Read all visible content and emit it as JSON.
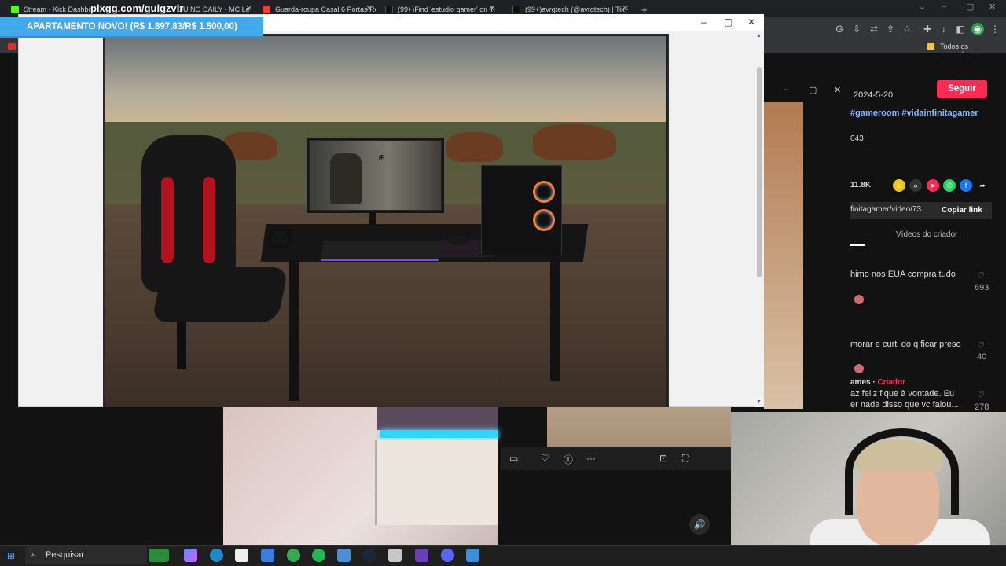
{
  "browser": {
    "tabs": [
      {
        "label": "Stream - Kick Dashboard",
        "favicon": "kick-icon"
      },
      {
        "label": "OU NO DAILY - MC Le",
        "favicon": "youtube-icon"
      },
      {
        "label": "Guarda-roupa Casal 6 Portas Re",
        "favicon": "store-icon"
      },
      {
        "label": "(99+)Find 'estudio gamer' on Ti",
        "favicon": "tiktok-icon"
      },
      {
        "label": "(99+)avrgtech (@avrgtech) | Tik",
        "favicon": "tiktok-icon"
      }
    ],
    "new_tab": "+",
    "bookmarks_label": "Todos os marcadores"
  },
  "overlay": {
    "stream_link": "pixgg.com/guigzvlr",
    "banner": "APARTAMENTO NOVO! (R$ 1.897,83/R$ 1.500,00)"
  },
  "tiktok": {
    "date": "2024-5-20",
    "hashtags": "#gameroom #vidainfinitagamer",
    "stat": "043",
    "likes": "11.8K",
    "follow_label": "Seguir",
    "link_text": "finitagamer/video/73...",
    "copy_label": "Copiar link",
    "tab_creator_videos": "Vídeos do criador",
    "comments": [
      {
        "text": "himo nos EUA compra tudo",
        "count": "693"
      },
      {
        "text": "morar e curti do q ficar preso",
        "count": "40"
      },
      {
        "author": "ames",
        "badge": "Criador",
        "text1": "az feliz fique à vontade. Eu",
        "text2": "er nada disso que vc falou...",
        "count": "278"
      }
    ]
  },
  "taskbar": {
    "search_placeholder": "Pesquisar"
  },
  "colors": {
    "banner_bg": "#43a9ea",
    "follow_bg": "#fe2c55",
    "led": "#2fd6ff"
  }
}
